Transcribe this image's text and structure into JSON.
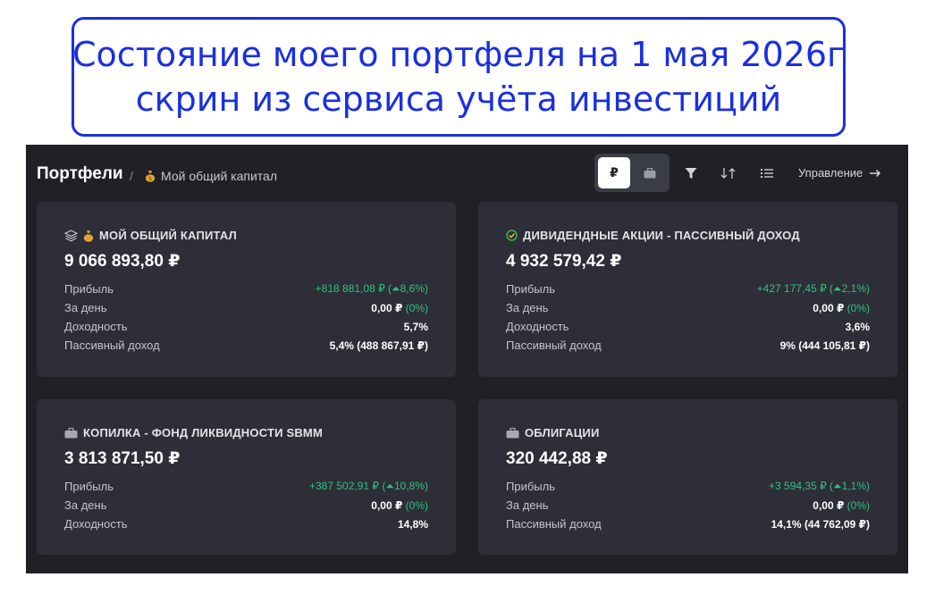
{
  "banner": {
    "line1": "Состояние моего портфеля на 1 мая 2026г",
    "line2": "скрин из сервиса учёта инвестиций"
  },
  "header": {
    "breadcrumb_root": "Портфели",
    "separator": "/",
    "current_portfolio": "Мой общий капитал",
    "currency_rub": "₽",
    "manage_label": "Управление"
  },
  "cards": [
    {
      "title": "МОЙ ОБЩИЙ КАПИТАЛ",
      "total": "9 066 893,80 ₽",
      "rows": [
        {
          "label": "Прибыль",
          "value": "+818 881,08 ₽ (⏶8,6%)"
        },
        {
          "label": "За день",
          "value": "0,00 ₽",
          "value_extra": "(0%)"
        },
        {
          "label": "Доходность",
          "value": "5,7%"
        },
        {
          "label": "Пассивный доход",
          "value": "5,4% (488 867,91 ₽)"
        }
      ]
    },
    {
      "title": "ДИВИДЕНДНЫЕ АКЦИИ - ПАССИВНЫЙ ДОХОД",
      "total": "4 932 579,42 ₽",
      "rows": [
        {
          "label": "Прибыль",
          "value": "+427 177,45 ₽ (⏶2,1%)"
        },
        {
          "label": "За день",
          "value": "0,00 ₽",
          "value_extra": "(0%)"
        },
        {
          "label": "Доходность",
          "value": "3,6%"
        },
        {
          "label": "Пассивный доход",
          "value": "9% (444 105,81 ₽)"
        }
      ]
    },
    {
      "title": "КОПИЛКА - ФОНД ЛИКВИДНОСТИ SBMM",
      "total": "3 813 871,50 ₽",
      "rows": [
        {
          "label": "Прибыль",
          "value": "+387 502,91 ₽ (⏶10,8%)"
        },
        {
          "label": "За день",
          "value": "0,00 ₽",
          "value_extra": "(0%)"
        },
        {
          "label": "Доходность",
          "value": "14,8%"
        }
      ]
    },
    {
      "title": "ОБЛИГАЦИИ",
      "total": "320 442,88 ₽",
      "rows": [
        {
          "label": "Прибыль",
          "value": "+3 594,35 ₽ (⏶1,1%)"
        },
        {
          "label": "За день",
          "value": "0,00 ₽",
          "value_extra": "(0%)"
        },
        {
          "label": "Пассивный доход",
          "value": "14,1% (44 762,09 ₽)"
        }
      ]
    }
  ],
  "colors": {
    "banner_blue": "#1a2fe0",
    "app_bg": "#202027",
    "card_bg": "#2d2e38",
    "positive_green": "#2ec27e"
  }
}
